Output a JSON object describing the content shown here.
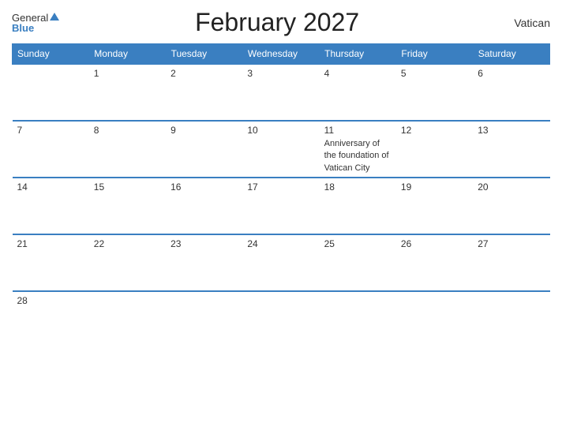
{
  "header": {
    "logo_general": "General",
    "logo_blue": "Blue",
    "title": "February 2027",
    "country": "Vatican"
  },
  "days_of_week": [
    "Sunday",
    "Monday",
    "Tuesday",
    "Wednesday",
    "Thursday",
    "Friday",
    "Saturday"
  ],
  "weeks": [
    [
      {
        "day": "",
        "event": ""
      },
      {
        "day": "1",
        "event": ""
      },
      {
        "day": "2",
        "event": ""
      },
      {
        "day": "3",
        "event": ""
      },
      {
        "day": "4",
        "event": ""
      },
      {
        "day": "5",
        "event": ""
      },
      {
        "day": "6",
        "event": ""
      }
    ],
    [
      {
        "day": "7",
        "event": ""
      },
      {
        "day": "8",
        "event": ""
      },
      {
        "day": "9",
        "event": ""
      },
      {
        "day": "10",
        "event": ""
      },
      {
        "day": "11",
        "event": "Anniversary of the foundation of Vatican City"
      },
      {
        "day": "12",
        "event": ""
      },
      {
        "day": "13",
        "event": ""
      }
    ],
    [
      {
        "day": "14",
        "event": ""
      },
      {
        "day": "15",
        "event": ""
      },
      {
        "day": "16",
        "event": ""
      },
      {
        "day": "17",
        "event": ""
      },
      {
        "day": "18",
        "event": ""
      },
      {
        "day": "19",
        "event": ""
      },
      {
        "day": "20",
        "event": ""
      }
    ],
    [
      {
        "day": "21",
        "event": ""
      },
      {
        "day": "22",
        "event": ""
      },
      {
        "day": "23",
        "event": ""
      },
      {
        "day": "24",
        "event": ""
      },
      {
        "day": "25",
        "event": ""
      },
      {
        "day": "26",
        "event": ""
      },
      {
        "day": "27",
        "event": ""
      }
    ],
    [
      {
        "day": "28",
        "event": ""
      },
      {
        "day": "",
        "event": ""
      },
      {
        "day": "",
        "event": ""
      },
      {
        "day": "",
        "event": ""
      },
      {
        "day": "",
        "event": ""
      },
      {
        "day": "",
        "event": ""
      },
      {
        "day": "",
        "event": ""
      }
    ]
  ]
}
